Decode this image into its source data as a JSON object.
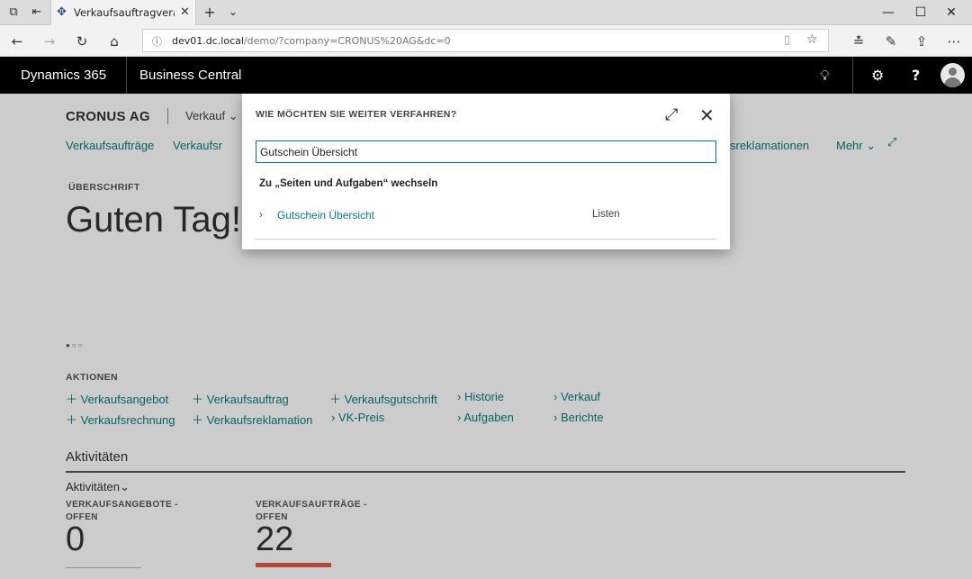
{
  "browser": {
    "tab_title": "Verkaufsauftragverarbei",
    "url_host": "dev01.dc.local",
    "url_path": "/demo/?company=CRONUS%20AG&dc=0"
  },
  "appbar": {
    "product": "Dynamics 365",
    "app": "Business Central",
    "help_label": "?"
  },
  "page": {
    "company": "CRONUS AG",
    "menu": "Verkauf",
    "nav_links": [
      "Verkaufsaufträge",
      "Verkaufsr",
      "sreklamationen",
      "Mehr"
    ],
    "headline_label": "ÜBERSCHRIFT",
    "greeting": "Guten Tag!",
    "actions_label": "AKTIONEN",
    "actions": [
      "Verkaufsangebot",
      "Verkaufsauftrag",
      "Verkaufsgutschrift",
      "Historie",
      "Verkauf",
      "Verkaufsrechnung",
      "Verkaufsreklamation",
      "VK-Preis",
      "Aufgaben",
      "Berichte"
    ],
    "activities_title": "Aktivitäten",
    "activities_sub": "Aktivitäten",
    "cues": [
      {
        "label_1": "VERKAUFSANGEBOTE -",
        "label_2": "OFFEN",
        "value": "0"
      },
      {
        "label_1": "VERKAUFSAUFTRÄGE -",
        "label_2": "OFFEN",
        "value": "22"
      }
    ]
  },
  "dialog": {
    "title": "WIE MÖCHTEN SIE WEITER VERFAHREN?",
    "search_value": "Gutschein Übersicht",
    "section": "Zu „Seiten und Aufgaben“ wechseln",
    "result_name": "Gutschein Übersicht",
    "result_category": "Listen"
  },
  "colors": {
    "accent": "#0a7c80",
    "appbar": "#000000",
    "cue_alert": "#e05a4f"
  }
}
